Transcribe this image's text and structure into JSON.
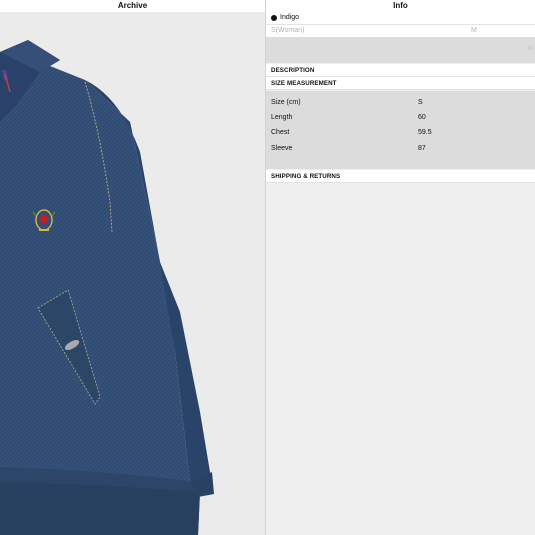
{
  "left_pane": {
    "title": "Archive",
    "image_alt": "indigo denim jacket with crest embroidery and button-flap pocket"
  },
  "right_pane": {
    "title": "Info",
    "color": {
      "name": "Indigo",
      "swatch": "#111111"
    },
    "sizes": [
      "S(Woman)",
      "M"
    ],
    "sections": {
      "description": "DESCRIPTION",
      "size_measurement": "SIZE MEASUREMENT",
      "shipping": "SHIPPING & RETURNS"
    },
    "measurements": [
      {
        "label": "Size (cm)",
        "value": "S"
      },
      {
        "label": "Length",
        "value": "60"
      },
      {
        "label": "Chest",
        "value": "59.5"
      },
      {
        "label": "Sleeve",
        "value": "87"
      }
    ]
  },
  "colors": {
    "denim": "#2f4a70",
    "denim_dark": "#223757",
    "panel_grey": "#dcdcdc",
    "background": "#efefef"
  }
}
